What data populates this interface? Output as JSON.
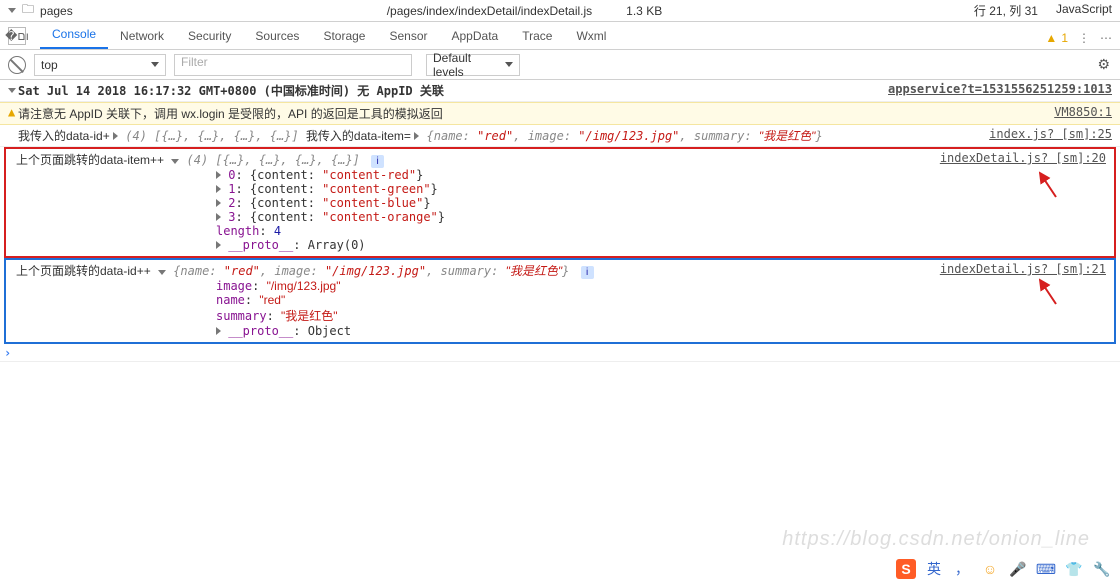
{
  "top": {
    "tree_item": "pages",
    "file_path": "/pages/index/indexDetail/indexDetail.js",
    "file_size": "1.3 KB",
    "cursor": "行 21, 列 31",
    "language": "JavaScript"
  },
  "tabs": {
    "items": [
      "Console",
      "Network",
      "Security",
      "Sources",
      "Storage",
      "Sensor",
      "AppData",
      "Trace",
      "Wxml"
    ],
    "active": "Console",
    "warn_count": "1"
  },
  "filter": {
    "context": "top",
    "filter_placeholder": "Filter",
    "level": "Default levels"
  },
  "logs": {
    "header_time": "Sat Jul 14 2018 16:17:32 GMT+0800 (中国标准时间) 无 AppID 关联",
    "header_src": "appservice?t=1531556251259:1013",
    "warn_text": "请注意无 AppID 关联下，调用 wx.login 是受限的，API 的返回是工具的模拟返回",
    "warn_src": "VM8850:1",
    "line3_pre": "我传入的data-id+ ",
    "line3_arr": "(4) [{…}, {…}, {…}, {…}]",
    "line3_mid": " 我传入的data-item= ",
    "line3_obj_open": "{",
    "line3_name_k": "name",
    "line3_name_v": "\"red\"",
    "line3_image_k": "image",
    "line3_image_v": "\"/img/123.jpg\"",
    "line3_summary_k": "summary",
    "line3_summary_v": "\"我是红色\"",
    "line3_obj_close": "}",
    "line3_src": "index.js? [sm]:25",
    "red_title": "上个页面跳转的data-item++",
    "red_arr_head": "(4) [{…}, {…}, {…}, {…}]",
    "red_rows": [
      {
        "idx": "0",
        "content": "\"content-red\""
      },
      {
        "idx": "1",
        "content": "\"content-green\""
      },
      {
        "idx": "2",
        "content": "\"content-blue\""
      },
      {
        "idx": "3",
        "content": "\"content-orange\""
      }
    ],
    "red_len_k": "length",
    "red_len_v": "4",
    "red_proto_k": "__proto__",
    "red_proto_v": "Array(0)",
    "red_src": "indexDetail.js? [sm]:20",
    "blue_title": "上个页面跳转的data-id++",
    "blue_obj_open": "{",
    "blue_name_k": "name",
    "blue_name_v": "\"red\"",
    "blue_image_k": "image",
    "blue_image_v": "\"/img/123.jpg\"",
    "blue_summary_k": "summary",
    "blue_summary_v": "\"我是红色\"",
    "blue_obj_close": "}",
    "blue_rows": [
      {
        "k": "image",
        "v": "\"/img/123.jpg\""
      },
      {
        "k": "name",
        "v": "\"red\""
      },
      {
        "k": "summary",
        "v": "\"我是红色\""
      }
    ],
    "blue_proto_k": "__proto__",
    "blue_proto_v": "Object",
    "blue_src": "indexDetail.js? [sm]:21"
  },
  "ime": {
    "label": "英"
  }
}
